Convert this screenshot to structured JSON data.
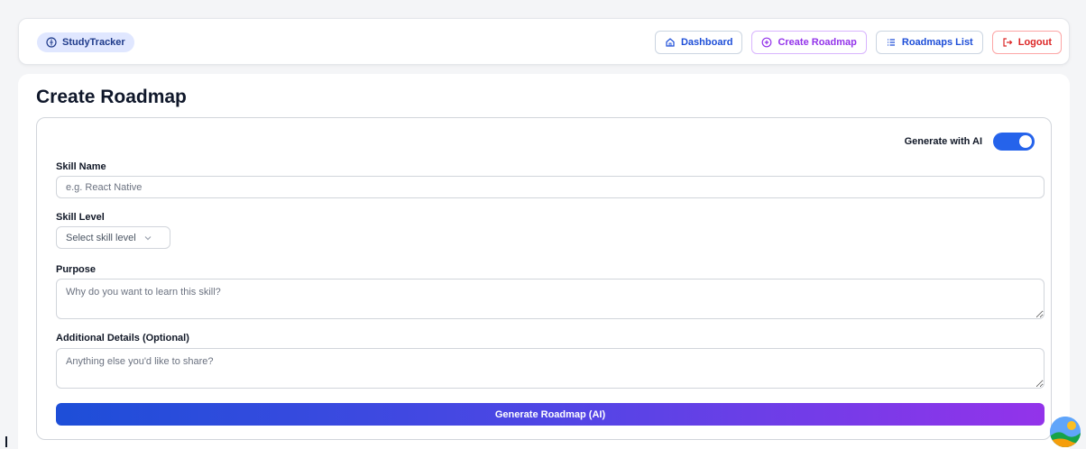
{
  "brand": {
    "name": "StudyTracker",
    "icon": "compass-icon"
  },
  "nav": [
    {
      "label": "Dashboard",
      "icon": "home-icon"
    },
    {
      "label": "Create Roadmap",
      "icon": "plus-circle-icon"
    },
    {
      "label": "Roadmaps List",
      "icon": "list-icon"
    },
    {
      "label": "Logout",
      "icon": "logout-icon"
    }
  ],
  "page": {
    "title": "Create Roadmap"
  },
  "form": {
    "ai_toggle_label": "Generate with AI",
    "ai_enabled": true,
    "skill_name": {
      "label": "Skill Name",
      "placeholder": "e.g. React Native",
      "value": ""
    },
    "skill_level": {
      "label": "Skill Level",
      "placeholder": "Select skill level"
    },
    "purpose": {
      "label": "Purpose",
      "placeholder": "Why do you want to learn this skill?"
    },
    "details": {
      "label": "Additional Details (Optional)",
      "placeholder": "Anything else you'd like to share?"
    },
    "submit_label": "Generate Roadmap (AI)"
  },
  "colors": {
    "primary": "#2563eb",
    "accent_purple": "#9333ea",
    "danger": "#dc2626",
    "brand_bg": "#e0e7ff"
  }
}
